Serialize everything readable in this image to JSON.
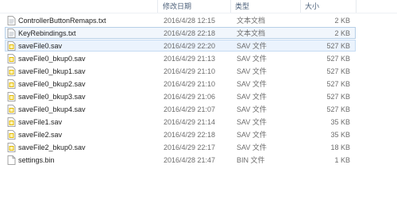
{
  "columns": {
    "date": "修改日期",
    "type": "类型",
    "size": "大小"
  },
  "colors": {
    "selected_border": "#b6cfe7",
    "hover_background": "#ebf3fd",
    "sav_icon_accent": "#e1b800"
  },
  "files": [
    {
      "name": "ControllerButtonRemaps.txt",
      "date": "2016/4/28 12:15",
      "type": "文本文档",
      "size": "2 KB",
      "icon": "text-file-icon"
    },
    {
      "name": "KeyRebindings.txt",
      "date": "2016/4/28 22:18",
      "type": "文本文档",
      "size": "2 KB",
      "icon": "text-file-icon",
      "state": "selected"
    },
    {
      "name": "saveFile0.sav",
      "date": "2016/4/29 22:20",
      "type": "SAV 文件",
      "size": "527 KB",
      "icon": "sav-file-icon",
      "state": "hover"
    },
    {
      "name": "saveFile0_bkup0.sav",
      "date": "2016/4/29 21:13",
      "type": "SAV 文件",
      "size": "527 KB",
      "icon": "sav-file-icon"
    },
    {
      "name": "saveFile0_bkup1.sav",
      "date": "2016/4/29 21:10",
      "type": "SAV 文件",
      "size": "527 KB",
      "icon": "sav-file-icon"
    },
    {
      "name": "saveFile0_bkup2.sav",
      "date": "2016/4/29 21:10",
      "type": "SAV 文件",
      "size": "527 KB",
      "icon": "sav-file-icon"
    },
    {
      "name": "saveFile0_bkup3.sav",
      "date": "2016/4/29 21:06",
      "type": "SAV 文件",
      "size": "527 KB",
      "icon": "sav-file-icon"
    },
    {
      "name": "saveFile0_bkup4.sav",
      "date": "2016/4/29 21:07",
      "type": "SAV 文件",
      "size": "527 KB",
      "icon": "sav-file-icon"
    },
    {
      "name": "saveFile1.sav",
      "date": "2016/4/29 21:14",
      "type": "SAV 文件",
      "size": "35 KB",
      "icon": "sav-file-icon"
    },
    {
      "name": "saveFile2.sav",
      "date": "2016/4/29 22:18",
      "type": "SAV 文件",
      "size": "35 KB",
      "icon": "sav-file-icon"
    },
    {
      "name": "saveFile2_bkup0.sav",
      "date": "2016/4/29 22:17",
      "type": "SAV 文件",
      "size": "18 KB",
      "icon": "sav-file-icon"
    },
    {
      "name": "settings.bin",
      "date": "2016/4/28 21:47",
      "type": "BIN 文件",
      "size": "1 KB",
      "icon": "bin-file-icon"
    }
  ]
}
